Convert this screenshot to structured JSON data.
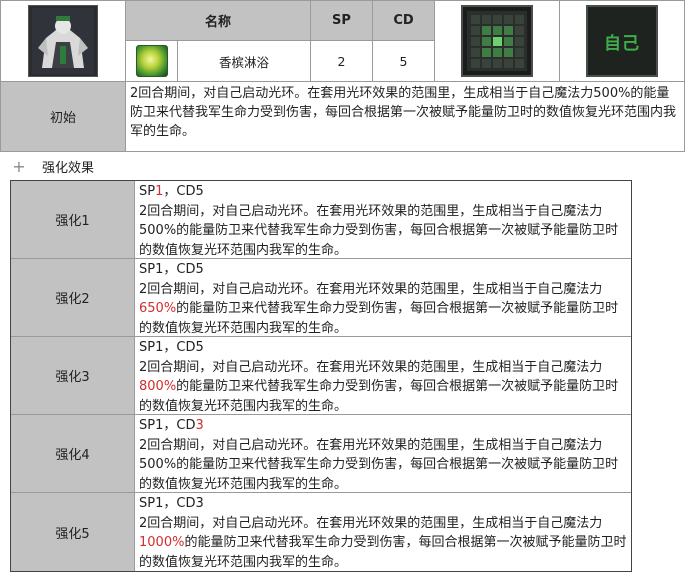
{
  "skill": {
    "header_name": "名称",
    "header_sp": "SP",
    "header_cd": "CD",
    "name": "香槟淋浴",
    "sp": "2",
    "cd": "5",
    "target_icon_text": "自己",
    "initial_label": "初始",
    "initial_desc": "2回合期间，对自己启动光环。在套用光环效果的范围里，生成相当于自己魔法力500%的能量防卫来代替我军生命力受到伤害，每回合根据第一次被赋予能量防卫时的数值恢复光环范围内我军的生命。"
  },
  "enhance": {
    "section_title": "强化效果",
    "rows": [
      {
        "label": "强化1",
        "line1_a": "SP",
        "line1_hl": "1",
        "line1_b": "，CD5",
        "body_a": "2回合期间，对自己启动光环。在套用光环效果的范围里，生成相当于自己魔法力500%的能量防卫来代替我军生命力受到伤害，每回合根据第一次被赋予能量防卫时的数值恢复光环范围内我军的生命。",
        "body_hl": "",
        "body_b": ""
      },
      {
        "label": "强化2",
        "line1_a": "SP1，CD5",
        "line1_hl": "",
        "line1_b": "",
        "body_a": "2回合期间，对自己启动光环。在套用光环效果的范围里，生成相当于自己魔法力",
        "body_hl": "650%",
        "body_b": "的能量防卫来代替我军生命力受到伤害，每回合根据第一次被赋予能量防卫时的数值恢复光环范围内我军的生命。"
      },
      {
        "label": "强化3",
        "line1_a": "SP1，CD5",
        "line1_hl": "",
        "line1_b": "",
        "body_a": "2回合期间，对自己启动光环。在套用光环效果的范围里，生成相当于自己魔法力",
        "body_hl": "800%",
        "body_b": "的能量防卫来代替我军生命力受到伤害，每回合根据第一次被赋予能量防卫时的数值恢复光环范围内我军的生命。"
      },
      {
        "label": "强化4",
        "line1_a": "SP1，CD",
        "line1_hl": "3",
        "line1_b": "",
        "body_a": "2回合期间，对自己启动光环。在套用光环效果的范围里，生成相当于自己魔法力500%的能量防卫来代替我军生命力受到伤害，每回合根据第一次被赋予能量防卫时的数值恢复光环范围内我军的生命。",
        "body_hl": "",
        "body_b": ""
      },
      {
        "label": "强化5",
        "line1_a": "SP1，CD3",
        "line1_hl": "",
        "line1_b": "",
        "body_a": "2回合期间，对自己启动光环。在套用光环效果的范围里，生成相当于自己魔法力",
        "body_hl": "1000%",
        "body_b": "的能量防卫来代替我军生命力受到伤害，每回合根据第一次被赋予能量防卫时的数值恢复光环范围内我军的生命。"
      }
    ]
  },
  "colors": {
    "highlight": "#d42d2d",
    "header_bg": "#c2c2c2",
    "icon_green": "#3fae4a"
  }
}
